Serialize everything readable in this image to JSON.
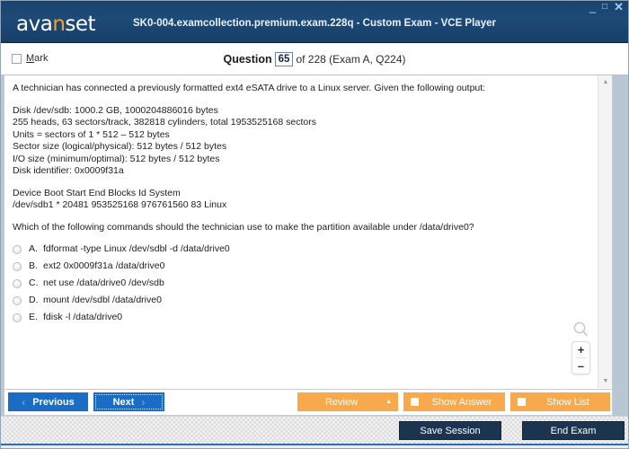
{
  "window": {
    "title": "SK0-004.examcollection.premium.exam.228q - Custom Exam - VCE Player",
    "logo_text_a": "ava",
    "logo_text_n": "n",
    "logo_text_b": "set",
    "minimize_icon": "_",
    "maximize_icon": "□",
    "close_icon": "✕",
    "brand_accent_color": "#f5a02a",
    "titlebar_color": "#1d4a77"
  },
  "question_header": {
    "mark_label_accel": "M",
    "mark_label_rest": "ark",
    "question_word": "Question",
    "question_number": "65",
    "of_text": "of 228 (Exam A, Q224)"
  },
  "question": {
    "intro": "A technician has connected a previously formatted ext4 eSATA drive to a Linux server. Given the following output:",
    "output_block_1": [
      "Disk /dev/sdb: 1000.2 GB, 1000204886016 bytes",
      "255 heads, 63 sectors/track, 382818 cylinders, total 1953525168 sectors",
      "Units = sectors of 1 * 512 – 512 bytes",
      "Sector size (logical/physical): 512 bytes / 512 bytes",
      "I/O size (minimum/optimal): 512 bytes / 512 bytes",
      "Disk identifier: 0x0009f31a"
    ],
    "output_block_2": [
      "Device Boot Start End Blocks Id System",
      "/dev/sdb1 * 20481 953525168 976761560 83 Linux"
    ],
    "prompt": "Which of the following commands should the technician use to make the partition available under /data/drive0?",
    "options": [
      {
        "letter": "A.",
        "text": "fdformat -type Linux /dev/sdbl -d /data/drive0",
        "selected": false
      },
      {
        "letter": "B.",
        "text": "ext2 0x0009f31a /data/drive0",
        "selected": false
      },
      {
        "letter": "C.",
        "text": "net use /data/drive0 /dev/sdb",
        "selected": false
      },
      {
        "letter": "D.",
        "text": "mount /dev/sdbl /data/drive0",
        "selected": false
      },
      {
        "letter": "E.",
        "text": "fdisk -l /data/drive0",
        "selected": false
      }
    ]
  },
  "zoom_control": {
    "magnifier_icon": "magnifier-icon",
    "zoom_in_label": "+",
    "zoom_out_label": "–"
  },
  "scrollbar": {
    "up_arrow": "▲",
    "down_arrow": "▼"
  },
  "toolbar": {
    "previous_label": "Previous",
    "previous_chevron": "‹",
    "next_label": "Next",
    "next_chevron": "›",
    "review_label": "Review",
    "review_triangle": "▲",
    "show_answer_label": "Show Answer",
    "show_answer_checked": false,
    "show_list_label": "Show List",
    "show_list_checked": false,
    "accent_blue": "#1a6cc4",
    "accent_orange": "#f8a94b"
  },
  "footer": {
    "save_session_label": "Save Session",
    "end_exam_label": "End Exam",
    "dark_button_color": "#1b3550"
  }
}
